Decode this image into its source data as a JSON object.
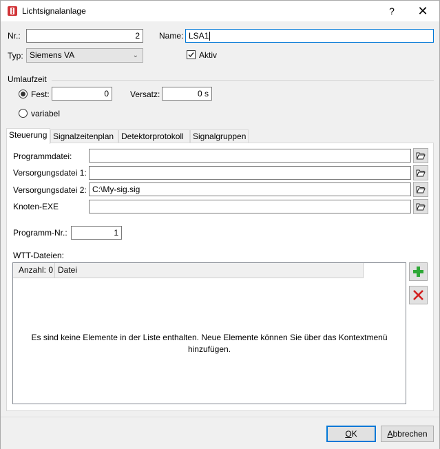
{
  "window": {
    "title": "Lichtsignalanlage",
    "help_label": "?",
    "close_label": "✕"
  },
  "header": {
    "nr_label": "Nr.:",
    "nr_value": "2",
    "name_label": "Name:",
    "name_value": "LSA1",
    "typ_label": "Typ:",
    "typ_value": "Siemens VA",
    "aktiv_label": "Aktiv",
    "aktiv_checked": true
  },
  "umlaufzeit": {
    "group_label": "Umlaufzeit",
    "fest_label": "Fest:",
    "fest_value": "0",
    "fest_selected": true,
    "versatz_label": "Versatz:",
    "versatz_value": "0 s",
    "variabel_label": "variabel"
  },
  "tabs": [
    {
      "label": "Steuerung",
      "active": true
    },
    {
      "label": "Signalzeitenplan",
      "active": false
    },
    {
      "label": "Detektorprotokoll",
      "active": false
    },
    {
      "label": "Signalgruppen",
      "active": false
    }
  ],
  "steuerung": {
    "programmdatei_label": "Programmdatei:",
    "programmdatei_value": "",
    "versorgung1_label": "Versorgungsdatei 1:",
    "versorgung1_value": "",
    "versorgung2_label": "Versorgungsdatei 2:",
    "versorgung2_value": "C:\\My-sig.sig",
    "knoten_label": "Knoten-EXE",
    "knoten_value": "",
    "programm_nr_label": "Programm-Nr.:",
    "programm_nr_value": "1",
    "wtt_label": "WTT-Dateien:",
    "wtt_columns": [
      "Anzahl: 0",
      "Datei"
    ],
    "wtt_empty_message": "Es sind keine Elemente in der Liste enthalten. Neue Elemente können Sie über das Kontextmenü hinzufügen."
  },
  "buttons": {
    "ok_label": "OK",
    "ok_accel": "O",
    "ok_rest": "K",
    "cancel_accel": "A",
    "cancel_rest": "bbrechen"
  },
  "icons": {
    "app": "traffic-light-icon",
    "browse": "folder-open-icon",
    "add": "plus-icon",
    "remove": "x-icon",
    "add_color": "#2ea836",
    "remove_color": "#d32020",
    "accent": "#0078d7"
  }
}
